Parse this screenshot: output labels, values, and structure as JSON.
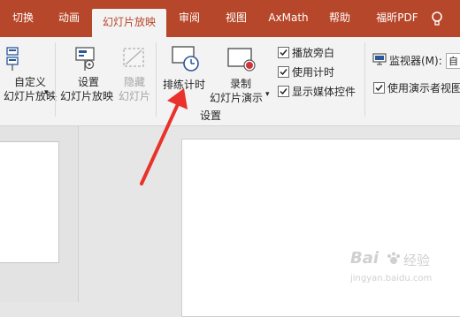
{
  "tabs": [
    {
      "label": "切换",
      "active": false
    },
    {
      "label": "动画",
      "active": false
    },
    {
      "label": "幻灯片放映",
      "active": true
    },
    {
      "label": "审阅",
      "active": false
    },
    {
      "label": "视图",
      "active": false
    },
    {
      "label": "AxMath",
      "active": false
    },
    {
      "label": "帮助",
      "active": false
    },
    {
      "label": "福昕PDF",
      "active": false
    }
  ],
  "ribbon": {
    "custom_show": {
      "line1": "自定义",
      "line2": "幻灯片放映",
      "dropdown": "▾"
    },
    "setup_show": {
      "line1": "设置",
      "line2": "幻灯片放映"
    },
    "hide_slide": {
      "line1": "隐藏",
      "line2": "幻灯片",
      "disabled": true
    },
    "rehearse_timings": {
      "label": "排练计时"
    },
    "record_show": {
      "line1": "录制",
      "line2": "幻灯片演示",
      "dropdown": "▾"
    },
    "checkboxes": [
      {
        "label": "播放旁白",
        "checked": true
      },
      {
        "label": "使用计时",
        "checked": true
      },
      {
        "label": "显示媒体控件",
        "checked": true
      }
    ],
    "group_setup_label": "设置",
    "monitor": {
      "label": "监视器(M):",
      "value": "自"
    },
    "presenter_view": {
      "label": "使用演示者视图",
      "checked": true
    }
  },
  "watermark": {
    "brand": "Bai",
    "brand_cn": "经验",
    "url": "jingyan.baidu.com"
  },
  "colors": {
    "accent": "#b7472a",
    "ribbon_bg": "#f3f3f3",
    "arrow": "#e8322b"
  }
}
